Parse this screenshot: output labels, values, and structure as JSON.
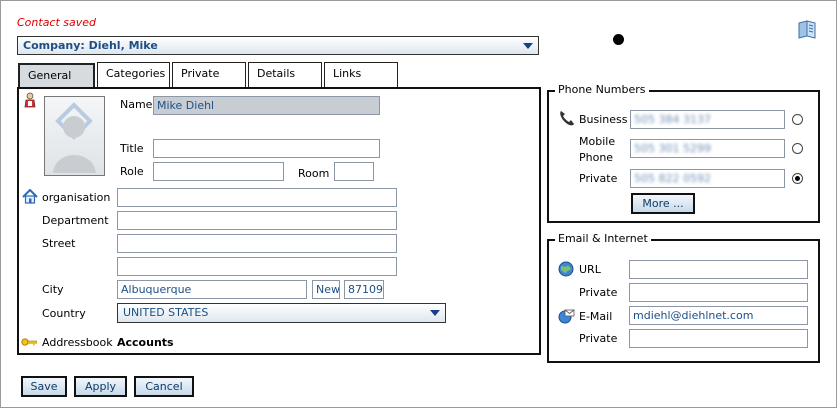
{
  "status": "Contact saved",
  "company_select": {
    "value": "Company: Diehl, Mike"
  },
  "tabs": [
    {
      "label": "General"
    },
    {
      "label": "Categories"
    },
    {
      "label": "Private"
    },
    {
      "label": "Details"
    },
    {
      "label": "Links"
    }
  ],
  "general": {
    "name_label": "Name",
    "name_value": "Mike Diehl",
    "title_label": "Title",
    "title_value": "",
    "role_label": "Role",
    "role_value": "",
    "room_label": "Room",
    "room_value": "",
    "organisation_label": "organisation",
    "organisation_value": "",
    "department_label": "Department",
    "department_value": "",
    "street_label": "Street",
    "street_value": "",
    "street2_value": "",
    "city_label": "City",
    "city_value": "Albuquerque",
    "state_value": "New",
    "zip_value": "87109",
    "country_label": "Country",
    "country_value": "UNITED STATES",
    "addressbook_label": "Addressbook",
    "addressbook_value": "Accounts"
  },
  "phone": {
    "legend": "Phone Numbers",
    "business_label": "Business",
    "business_value": "505 384 3137",
    "mobile_label_1": "Mobile",
    "mobile_label_2": "Phone",
    "mobile_value": "505 301 5299",
    "private_label": "Private",
    "private_value": "505 822 0592",
    "more_button": "More ..."
  },
  "email": {
    "legend": "Email & Internet",
    "url_label": "URL",
    "url_value": "",
    "url_private_label": "Private",
    "url_private_value": "",
    "email_label": "E-Mail",
    "email_value": "mdiehl@diehlnet.com",
    "email_private_label": "Private",
    "email_private_value": ""
  },
  "buttons": {
    "save": "Save",
    "apply": "Apply",
    "cancel": "Cancel"
  },
  "colors": {
    "status": "#e00000",
    "link_text": "#1d4f87",
    "panel_border": "#111111"
  },
  "icons": [
    "person-icon",
    "photo-placeholder-icon",
    "home-icon",
    "key-icon",
    "phone-icon",
    "globe-icon",
    "email-icon",
    "address-book-icon"
  ]
}
